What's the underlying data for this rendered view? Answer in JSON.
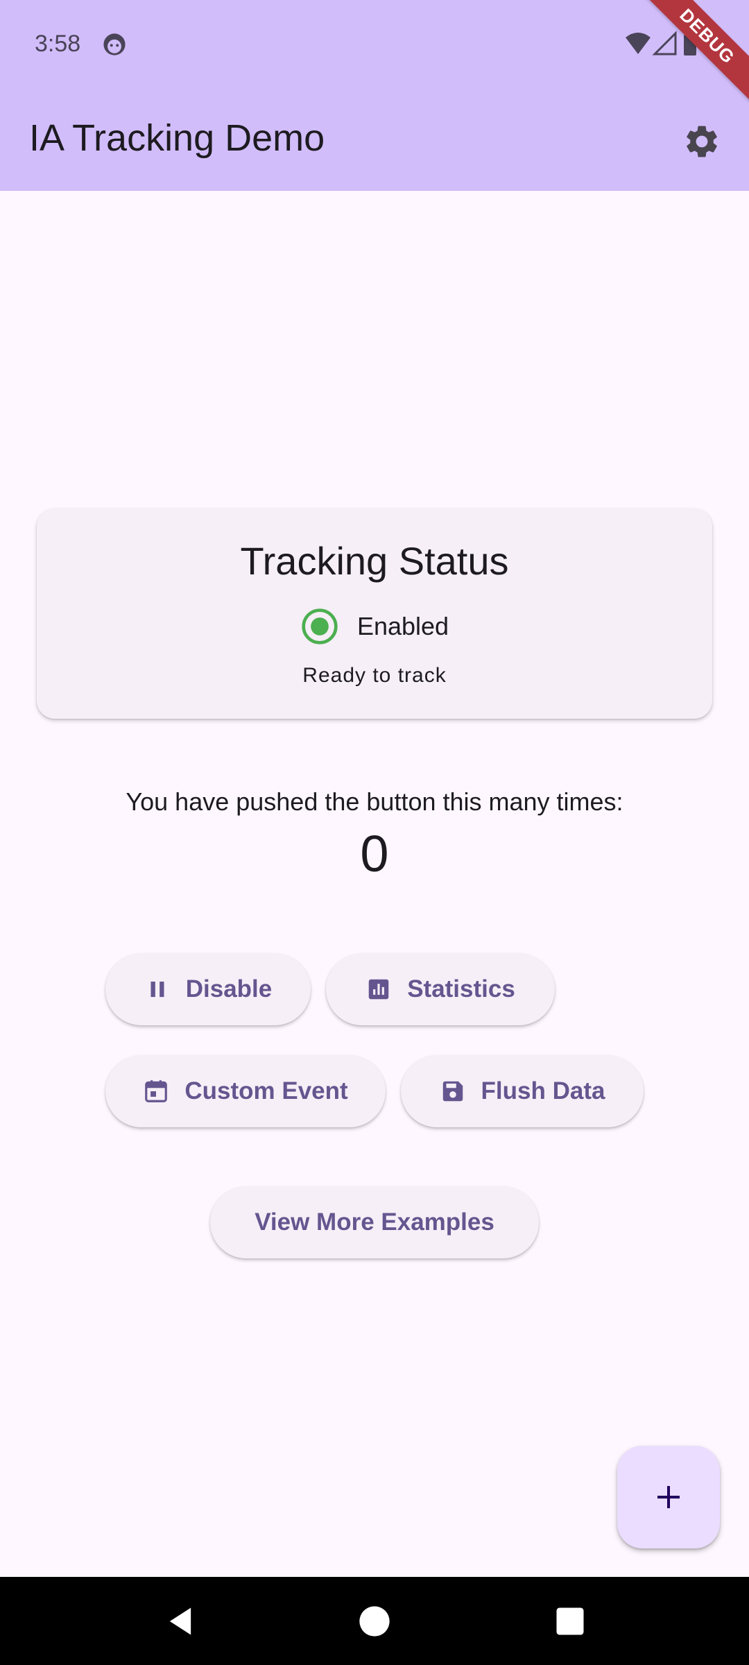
{
  "status_bar": {
    "time": "3:58",
    "debug_label": "DEBUG"
  },
  "app_bar": {
    "title": "IA Tracking Demo"
  },
  "tracking_card": {
    "title": "Tracking Status",
    "status": "Enabled",
    "subtitle": "Ready to track",
    "status_color": "#4caf50"
  },
  "counter": {
    "label": "You have pushed the button this many times:",
    "value": "0"
  },
  "buttons": {
    "disable": "Disable",
    "statistics": "Statistics",
    "custom_event": "Custom Event",
    "flush_data": "Flush Data",
    "view_more": "View More Examples"
  },
  "icons": {
    "settings": "gear-icon",
    "disable": "pause-icon",
    "statistics": "bar-chart-icon",
    "custom_event": "calendar-icon",
    "flush_data": "save-icon",
    "fab": "plus-icon"
  },
  "colors": {
    "app_bar": "#d2bdfb",
    "background": "#fef7ff",
    "accent": "#65558f",
    "fab": "#eaddff"
  }
}
